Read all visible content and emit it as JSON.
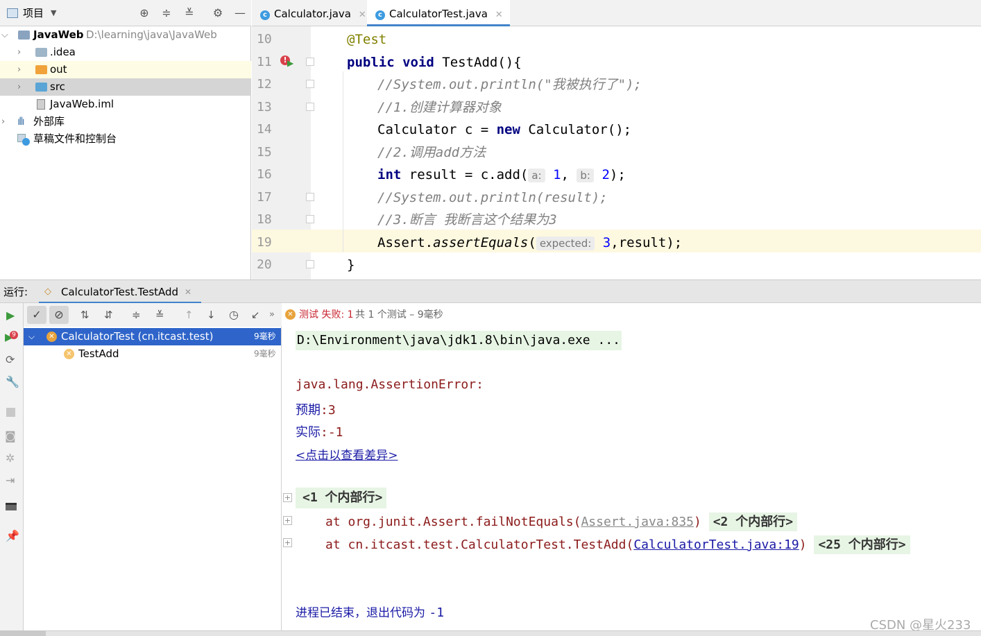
{
  "project_panel": {
    "title": "项目",
    "tree": [
      {
        "label": "JavaWeb",
        "path": "D:\\learning\\java\\JavaWeb",
        "expanded": true
      },
      {
        "label": ".idea"
      },
      {
        "label": "out"
      },
      {
        "label": "src"
      },
      {
        "label": "JavaWeb.iml"
      },
      {
        "label": "外部库"
      },
      {
        "label": "草稿文件和控制台"
      }
    ]
  },
  "editor": {
    "tabs": [
      {
        "label": "Calculator.java",
        "active": false
      },
      {
        "label": "CalculatorTest.java",
        "active": true
      }
    ],
    "line_numbers": [
      "10",
      "11",
      "12",
      "13",
      "14",
      "15",
      "16",
      "17",
      "18",
      "19",
      "20"
    ],
    "code": {
      "l10": "@Test",
      "l11_kw1": "public",
      "l11_kw2": "void",
      "l11_rest": " TestAdd(){",
      "l12": "//System.out.println(\"我被执行了\");",
      "l13": "//1.创建计算器对象",
      "l14_a": "Calculator c = ",
      "l14_kw": "new",
      "l14_b": " Calculator();",
      "l15": "//2.调用add方法",
      "l16_kw": "int",
      "l16_a": " result = c.add(",
      "l16_hint_a": "a:",
      "l16_num1": "1",
      "l16_sep": ", ",
      "l16_hint_b": "b:",
      "l16_num2": "2",
      "l16_end": ");",
      "l17": "//System.out.println(result);",
      "l18": "//3.断言 我断言这个结果为3",
      "l19_a": "Assert.",
      "l19_method": "assertEquals",
      "l19_paren": "(",
      "l19_hint": "expected:",
      "l19_num": "3",
      "l19_end": ",result);",
      "l20": "}"
    }
  },
  "run_panel": {
    "run_label": "运行:",
    "run_tab": "CalculatorTest.TestAdd",
    "status_fail": "测试 失败: 1",
    "status_rest": "共 1 个测试 – 9毫秒",
    "tests": [
      {
        "label": "CalculatorTest (cn.itcast.test)",
        "time": "9毫秒"
      },
      {
        "label": "TestAdd",
        "time": "9毫秒"
      }
    ],
    "console": {
      "cmd": "D:\\Environment\\java\\jdk1.8\\bin\\java.exe ...",
      "error": "java.lang.AssertionError: ",
      "expected_label": "预期",
      "expected_value": ":3",
      "actual_label": "实际",
      "actual_value": ":-1",
      "diff_link": "<点击以查看差异>",
      "fold1": "<1 个内部行>",
      "trace1_a": "at org.junit.Assert.failNotEquals(",
      "trace1_link": "Assert.java:835",
      "trace1_b": ")",
      "fold2": "<2 个内部行>",
      "trace2_a": "at cn.itcast.test.CalculatorTest.TestAdd(",
      "trace2_link": "CalculatorTest.java:19",
      "trace2_b": ")",
      "fold3": "<25 个内部行>",
      "exit_label": "进程已结束，退出代码为 ",
      "exit_code": "-1"
    }
  },
  "watermark": "CSDN @星火233"
}
